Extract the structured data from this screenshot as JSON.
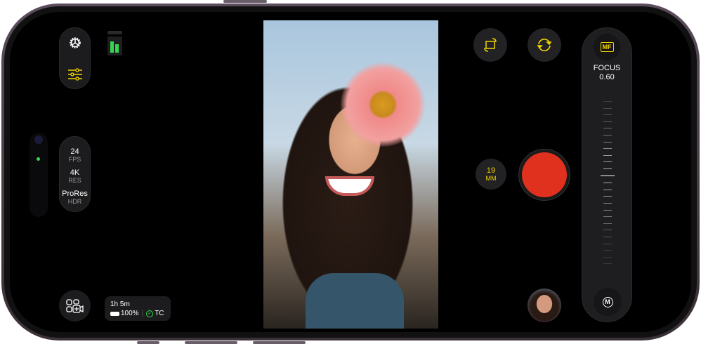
{
  "left_controls": {
    "settings_icon": "gear-icon",
    "adjust_icon": "sliders-icon",
    "audio_meter_icon": "audio-level-icon"
  },
  "format": {
    "fps_value": "24",
    "fps_label": "FPS",
    "res_value": "4K",
    "res_label": "RES",
    "codec_value": "ProRes",
    "codec_label": "HDR"
  },
  "status": {
    "time_remaining": "1h 5m",
    "battery": "100%",
    "timecode": "TC"
  },
  "right_controls": {
    "lens_value": "19",
    "lens_unit": "MM"
  },
  "focus": {
    "mode_badge": "MF",
    "label": "FOCUS",
    "value": "0.60",
    "auto_button": "M"
  },
  "colors": {
    "accent": "#f2d400",
    "record": "#e0301e",
    "meter": "#32d74b"
  }
}
